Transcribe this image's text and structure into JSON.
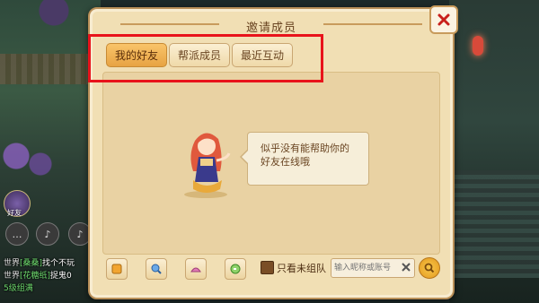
{
  "dialog": {
    "title": "邀请成员",
    "tabs": [
      {
        "label": "我的好友",
        "active": true
      },
      {
        "label": "帮派成员",
        "active": false
      },
      {
        "label": "最近互动",
        "active": false
      }
    ],
    "empty_message": "似乎没有能帮助你的好友在线哦",
    "filter_label": "只看未组队",
    "search_placeholder": "输入昵称或账号",
    "icons": {
      "close": "close-icon",
      "tool1": "team-icon",
      "tool2": "magnifier-icon",
      "tool3": "pet-icon",
      "tool4": "refresh-icon",
      "search": "search-icon"
    }
  },
  "hud": {
    "friend_button_label": "好友",
    "chat": [
      {
        "tag": "世界",
        "name": "[桑桑]",
        "text": "找个不玩"
      },
      {
        "tag": "世界",
        "name": "[花糖纸]",
        "text": "捉鬼0"
      },
      {
        "tag": "",
        "name": "",
        "text": "5级组满"
      }
    ]
  },
  "colors": {
    "highlight": "#e8131b",
    "tab_active": "#f0b35a",
    "panel": "#f1dfb4"
  }
}
